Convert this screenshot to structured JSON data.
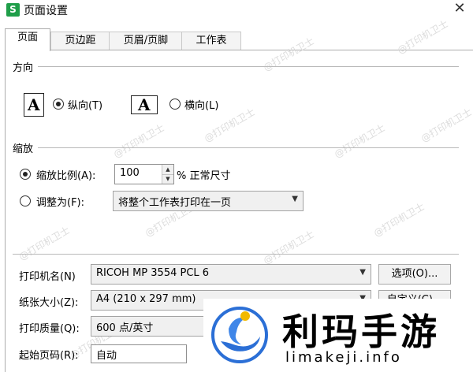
{
  "window": {
    "app_icon_letter": "S",
    "title": "页面设置",
    "close_glyph": "✕"
  },
  "tabs": [
    {
      "label": "页面",
      "active": true
    },
    {
      "label": "页边距",
      "active": false
    },
    {
      "label": "页眉/页脚",
      "active": false
    },
    {
      "label": "工作表",
      "active": false
    }
  ],
  "orientation": {
    "group_label": "方向",
    "icon_letter": "A",
    "portrait_label": "纵向(T)",
    "landscape_label": "横向(L)",
    "selected": "portrait"
  },
  "scaling": {
    "group_label": "缩放",
    "scale_label": "缩放比例(A):",
    "scale_value": "100",
    "scale_suffix": "% 正常尺寸",
    "fit_label": "调整为(F):",
    "fit_option": "将整个工作表打印在一页",
    "selected": "scale"
  },
  "printer": {
    "name_label": "打印机名(N)",
    "name_value": "RICOH MP 3554 PCL 6",
    "options_button": "选项(O)...",
    "paper_label": "纸张大小(Z):",
    "paper_value": "A4 (210 x 297 mm)",
    "custom_button": "自定义(C)...",
    "quality_label": "打印质量(Q):",
    "quality_value": "600 点/英寸",
    "start_page_label": "起始页码(R):",
    "start_page_value": "自动"
  },
  "watermark": {
    "text": "@打印机卫士"
  },
  "brand": {
    "name": "利玛手游",
    "url": "limakeji.info"
  },
  "colors": {
    "app_icon_bg": "#1f9e49",
    "brand_blue": "#2b6fd6",
    "brand_yellow": "#f2b900"
  }
}
